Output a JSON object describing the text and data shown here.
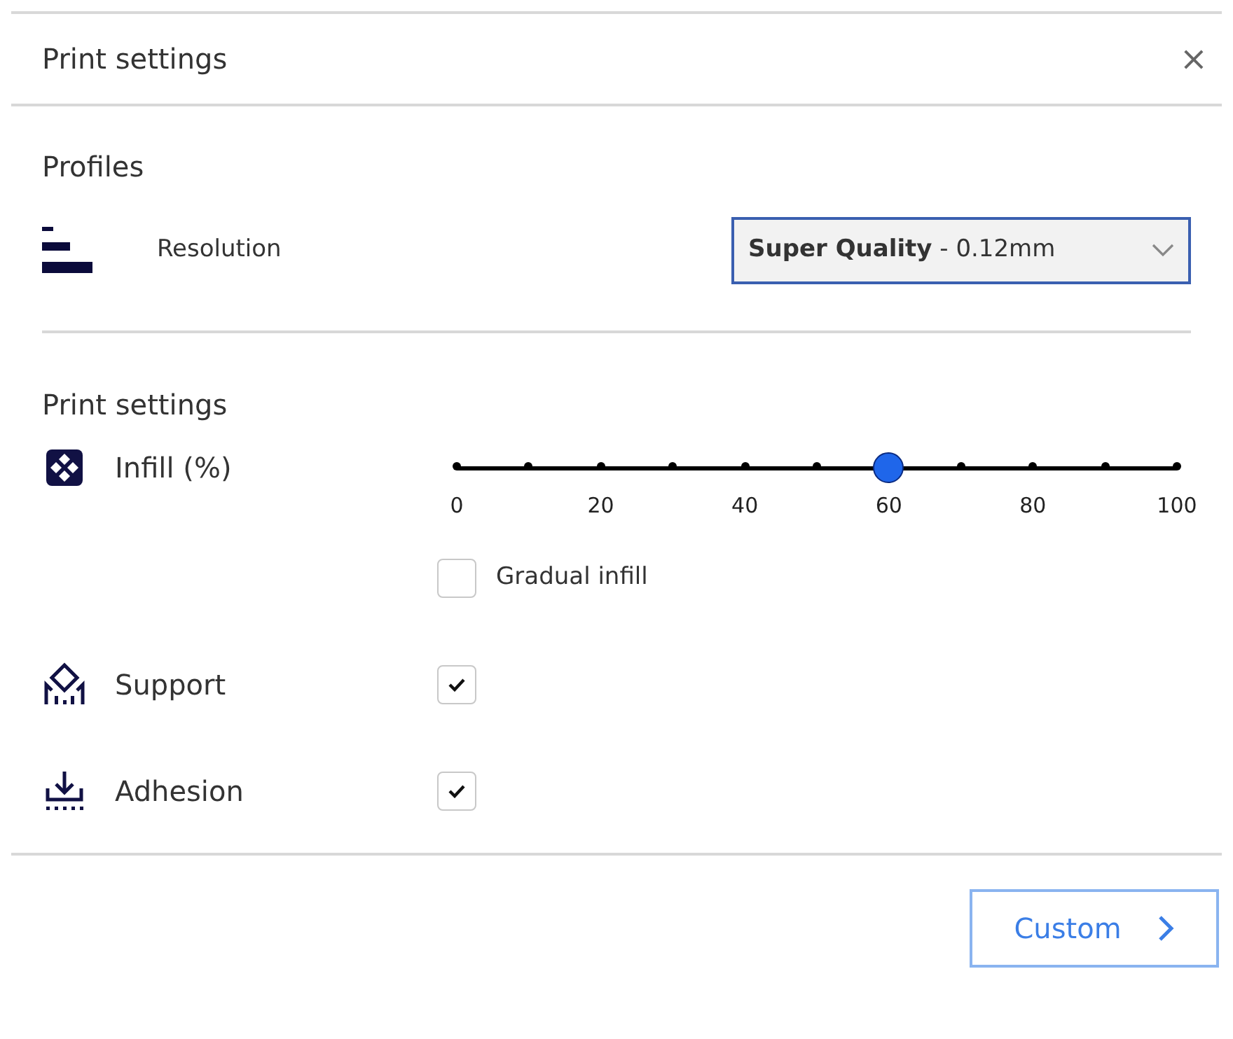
{
  "window": {
    "title": "Print settings",
    "close": "×"
  },
  "profiles": {
    "heading": "Profiles",
    "label": "Resolution",
    "value": "**Super Quality** - 0.12mm"
  },
  "print_settings": {
    "heading": "Print settings",
    "rows": [
      {
        "kind": "slider",
        "label": "Infill (%)",
        "level": 0.6,
        "ticks": [
          "0",
          "20",
          "40",
          "60",
          "80",
          "100"
        ],
        "option": {
          "label": "Gradual infill",
          "checked": false
        }
      },
      {
        "kind": "checkbox",
        "label": "Support",
        "checked": true
      },
      {
        "kind": "checkbox",
        "label": "Adhesion",
        "checked": true
      }
    ]
  },
  "footer": {
    "button": "Custom"
  }
}
